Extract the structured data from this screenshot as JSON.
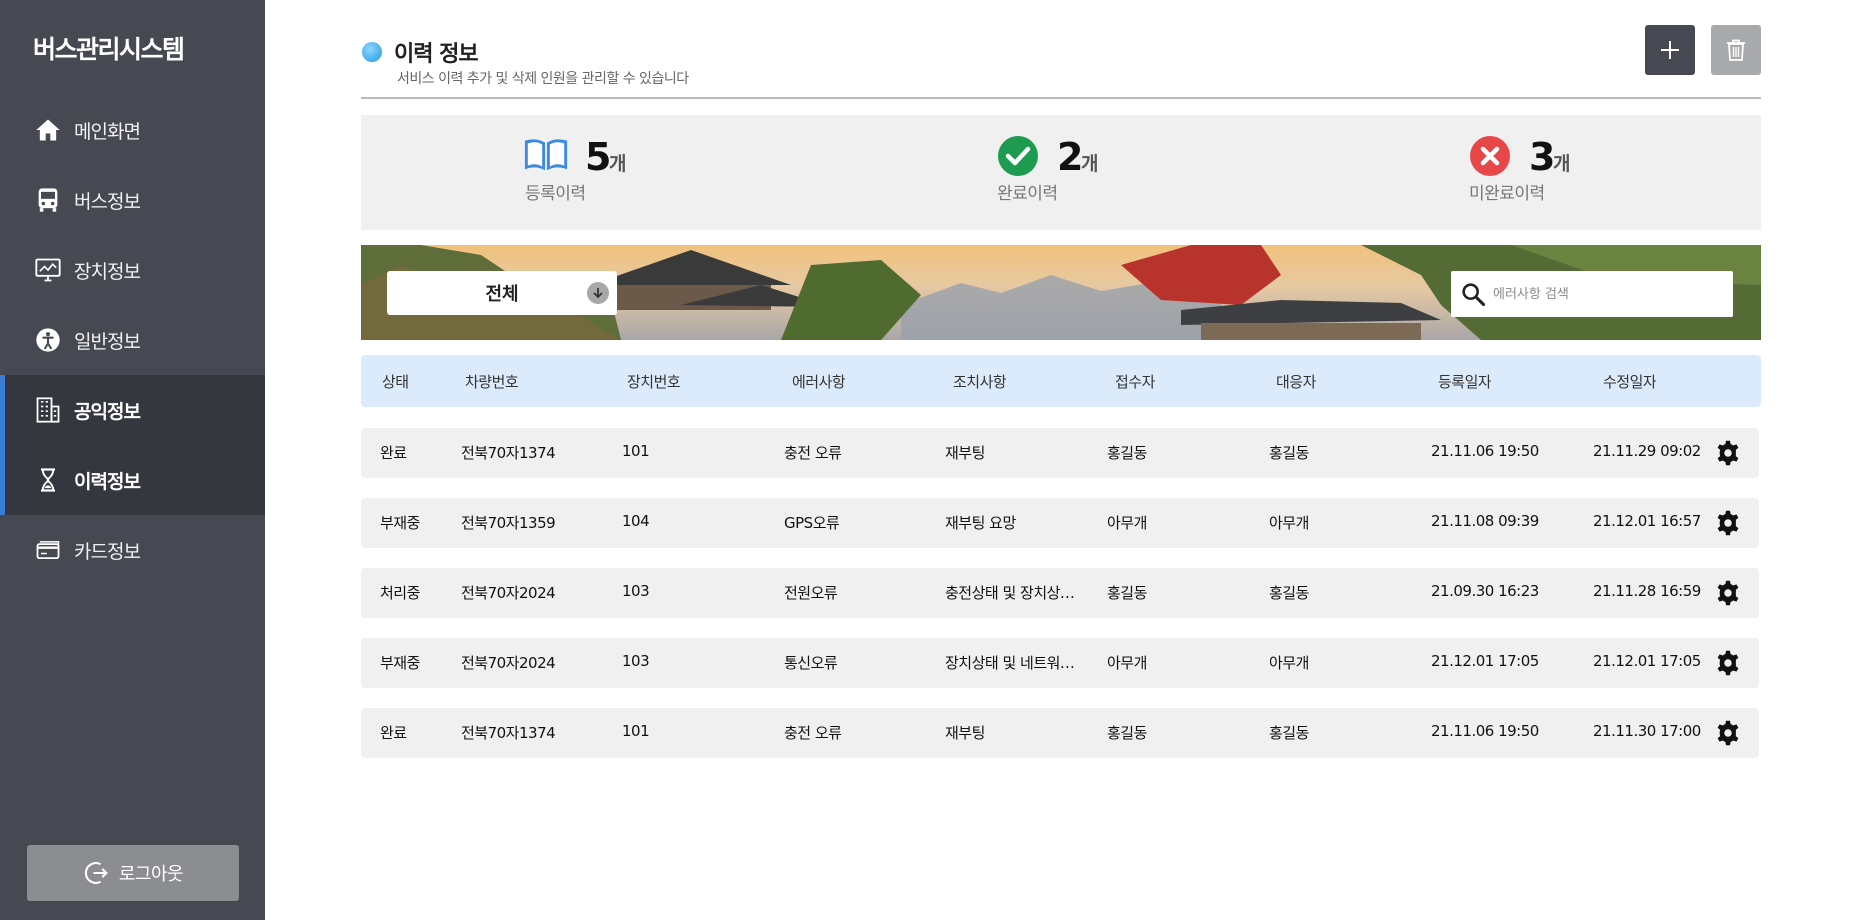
{
  "sidebar": {
    "brand": "버스관리시스템",
    "items": [
      {
        "label": "메인화면",
        "icon": "home-icon"
      },
      {
        "label": "버스정보",
        "icon": "bus-icon"
      },
      {
        "label": "장치정보",
        "icon": "monitor-icon"
      },
      {
        "label": "일반정보",
        "icon": "person-icon"
      },
      {
        "label": "공익정보",
        "icon": "building-icon"
      },
      {
        "label": "이력정보",
        "icon": "hourglass-icon"
      },
      {
        "label": "카드정보",
        "icon": "card-icon"
      }
    ],
    "active_items": [
      "공익정보",
      "이력정보"
    ],
    "logout_label": "로그아웃"
  },
  "header": {
    "title": "이력 정보",
    "subtitle": "서비스 이력 추가 및 삭제 인원을 관리할 수 있습니다",
    "add_icon": "plus-icon",
    "delete_icon": "trash-icon"
  },
  "stats": [
    {
      "value": "5",
      "unit": "개",
      "label": "등록이력",
      "icon": "book-icon",
      "color": "#3d8be0"
    },
    {
      "value": "2",
      "unit": "개",
      "label": "완료이력",
      "icon": "check-circle-icon",
      "color": "#1e9b51"
    },
    {
      "value": "3",
      "unit": "개",
      "label": "미완료이력",
      "icon": "x-circle-icon",
      "color": "#e8474a"
    }
  ],
  "filter": {
    "selected": "전체"
  },
  "search": {
    "placeholder": "에러사항 검색"
  },
  "table": {
    "columns": [
      "상태",
      "차량번호",
      "장치번호",
      "에러사항",
      "조치사항",
      "접수자",
      "대응자",
      "등록일자",
      "수정일자"
    ],
    "rows": [
      [
        "완료",
        "전북70자1374",
        "101",
        "충전 오류",
        "재부팅",
        "홍길동",
        "홍길동",
        "21.11.06 19:50",
        "21.11.29 09:02"
      ],
      [
        "부재중",
        "전북70자1359",
        "104",
        "GPS오류",
        "재부팅 요망",
        "아무개",
        "아무개",
        "21.11.08 09:39",
        "21.12.01 16:57"
      ],
      [
        "처리중",
        "전북70자2024",
        "103",
        "전원오류",
        "충전상태 및 장치상…",
        "홍길동",
        "홍길동",
        "21.09.30 16:23",
        "21.11.28 16:59"
      ],
      [
        "부재중",
        "전북70자2024",
        "103",
        "통신오류",
        "장치상태 및 네트워…",
        "아무개",
        "아무개",
        "21.12.01 17:05",
        "21.12.01 17:05"
      ],
      [
        "완료",
        "전북70자1374",
        "101",
        "충전 오류",
        "재부팅",
        "홍길동",
        "홍길동",
        "21.11.06 19:50",
        "21.11.30 17:00"
      ]
    ]
  },
  "colors": {
    "sidebar_bg": "#464951",
    "sidebar_active_bg": "#34373d",
    "accent": "#3a7bd5",
    "table_header_bg": "#dcebfb",
    "row_bg": "#f0f0f0"
  }
}
